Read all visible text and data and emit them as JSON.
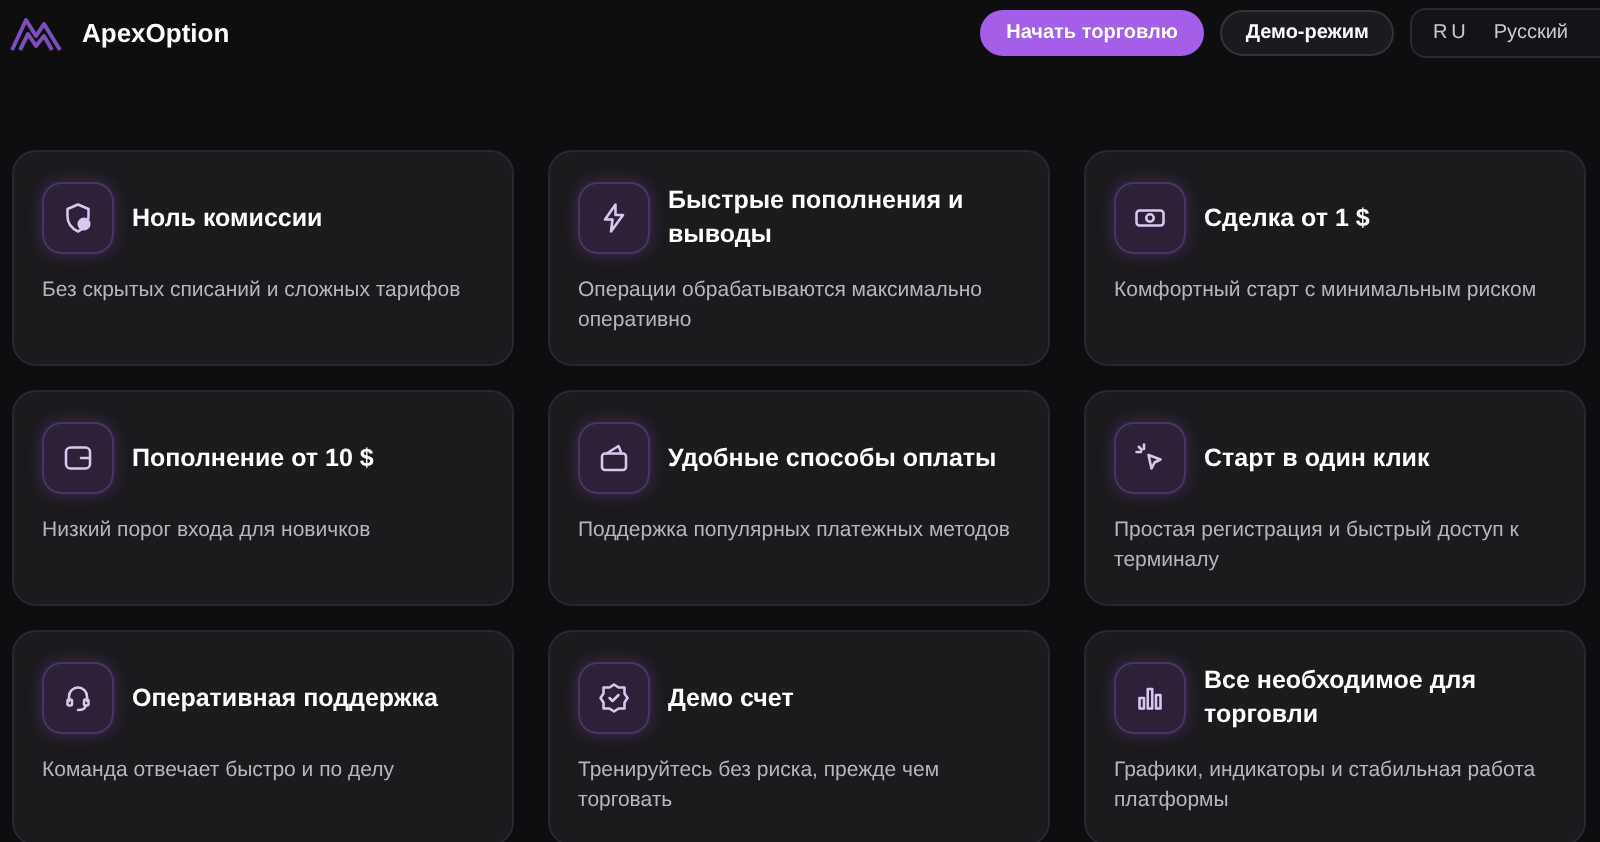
{
  "header": {
    "brand": "ApexOption",
    "buttons": [
      {
        "label": "Начать торговлю",
        "primary": true
      },
      {
        "label": "Демо-режим",
        "primary": false
      }
    ],
    "language": {
      "code": "RU",
      "name": "Русский"
    }
  },
  "features": [
    {
      "title": "Ноль комиссии",
      "text": "Без скрытых списаний и сложных тарифов"
    },
    {
      "title": "Быстрые пополнения и выводы",
      "text": "Операции обрабатываются максимально оперативно"
    },
    {
      "title": "Сделка от 1 $",
      "text": "Комфортный старт с минимальным риском"
    },
    {
      "title": "Пополнение от 10 $",
      "text": "Низкий порог входа для новичков"
    },
    {
      "title": "Удобные способы оплаты",
      "text": "Поддержка популярных платежных методов"
    },
    {
      "title": "Старт в один клик",
      "text": "Простая регистрация и быстрый доступ к терминалу"
    },
    {
      "title": "Оперативная поддержка",
      "text": "Команда отвечает быстро и по делу"
    },
    {
      "title": "Демо счет",
      "text": "Тренируйтесь без риска, прежде чем торговать"
    },
    {
      "title": "Все необходимое для торговли",
      "text": "Графики, индикаторы и стабильная работа платформы"
    }
  ]
}
